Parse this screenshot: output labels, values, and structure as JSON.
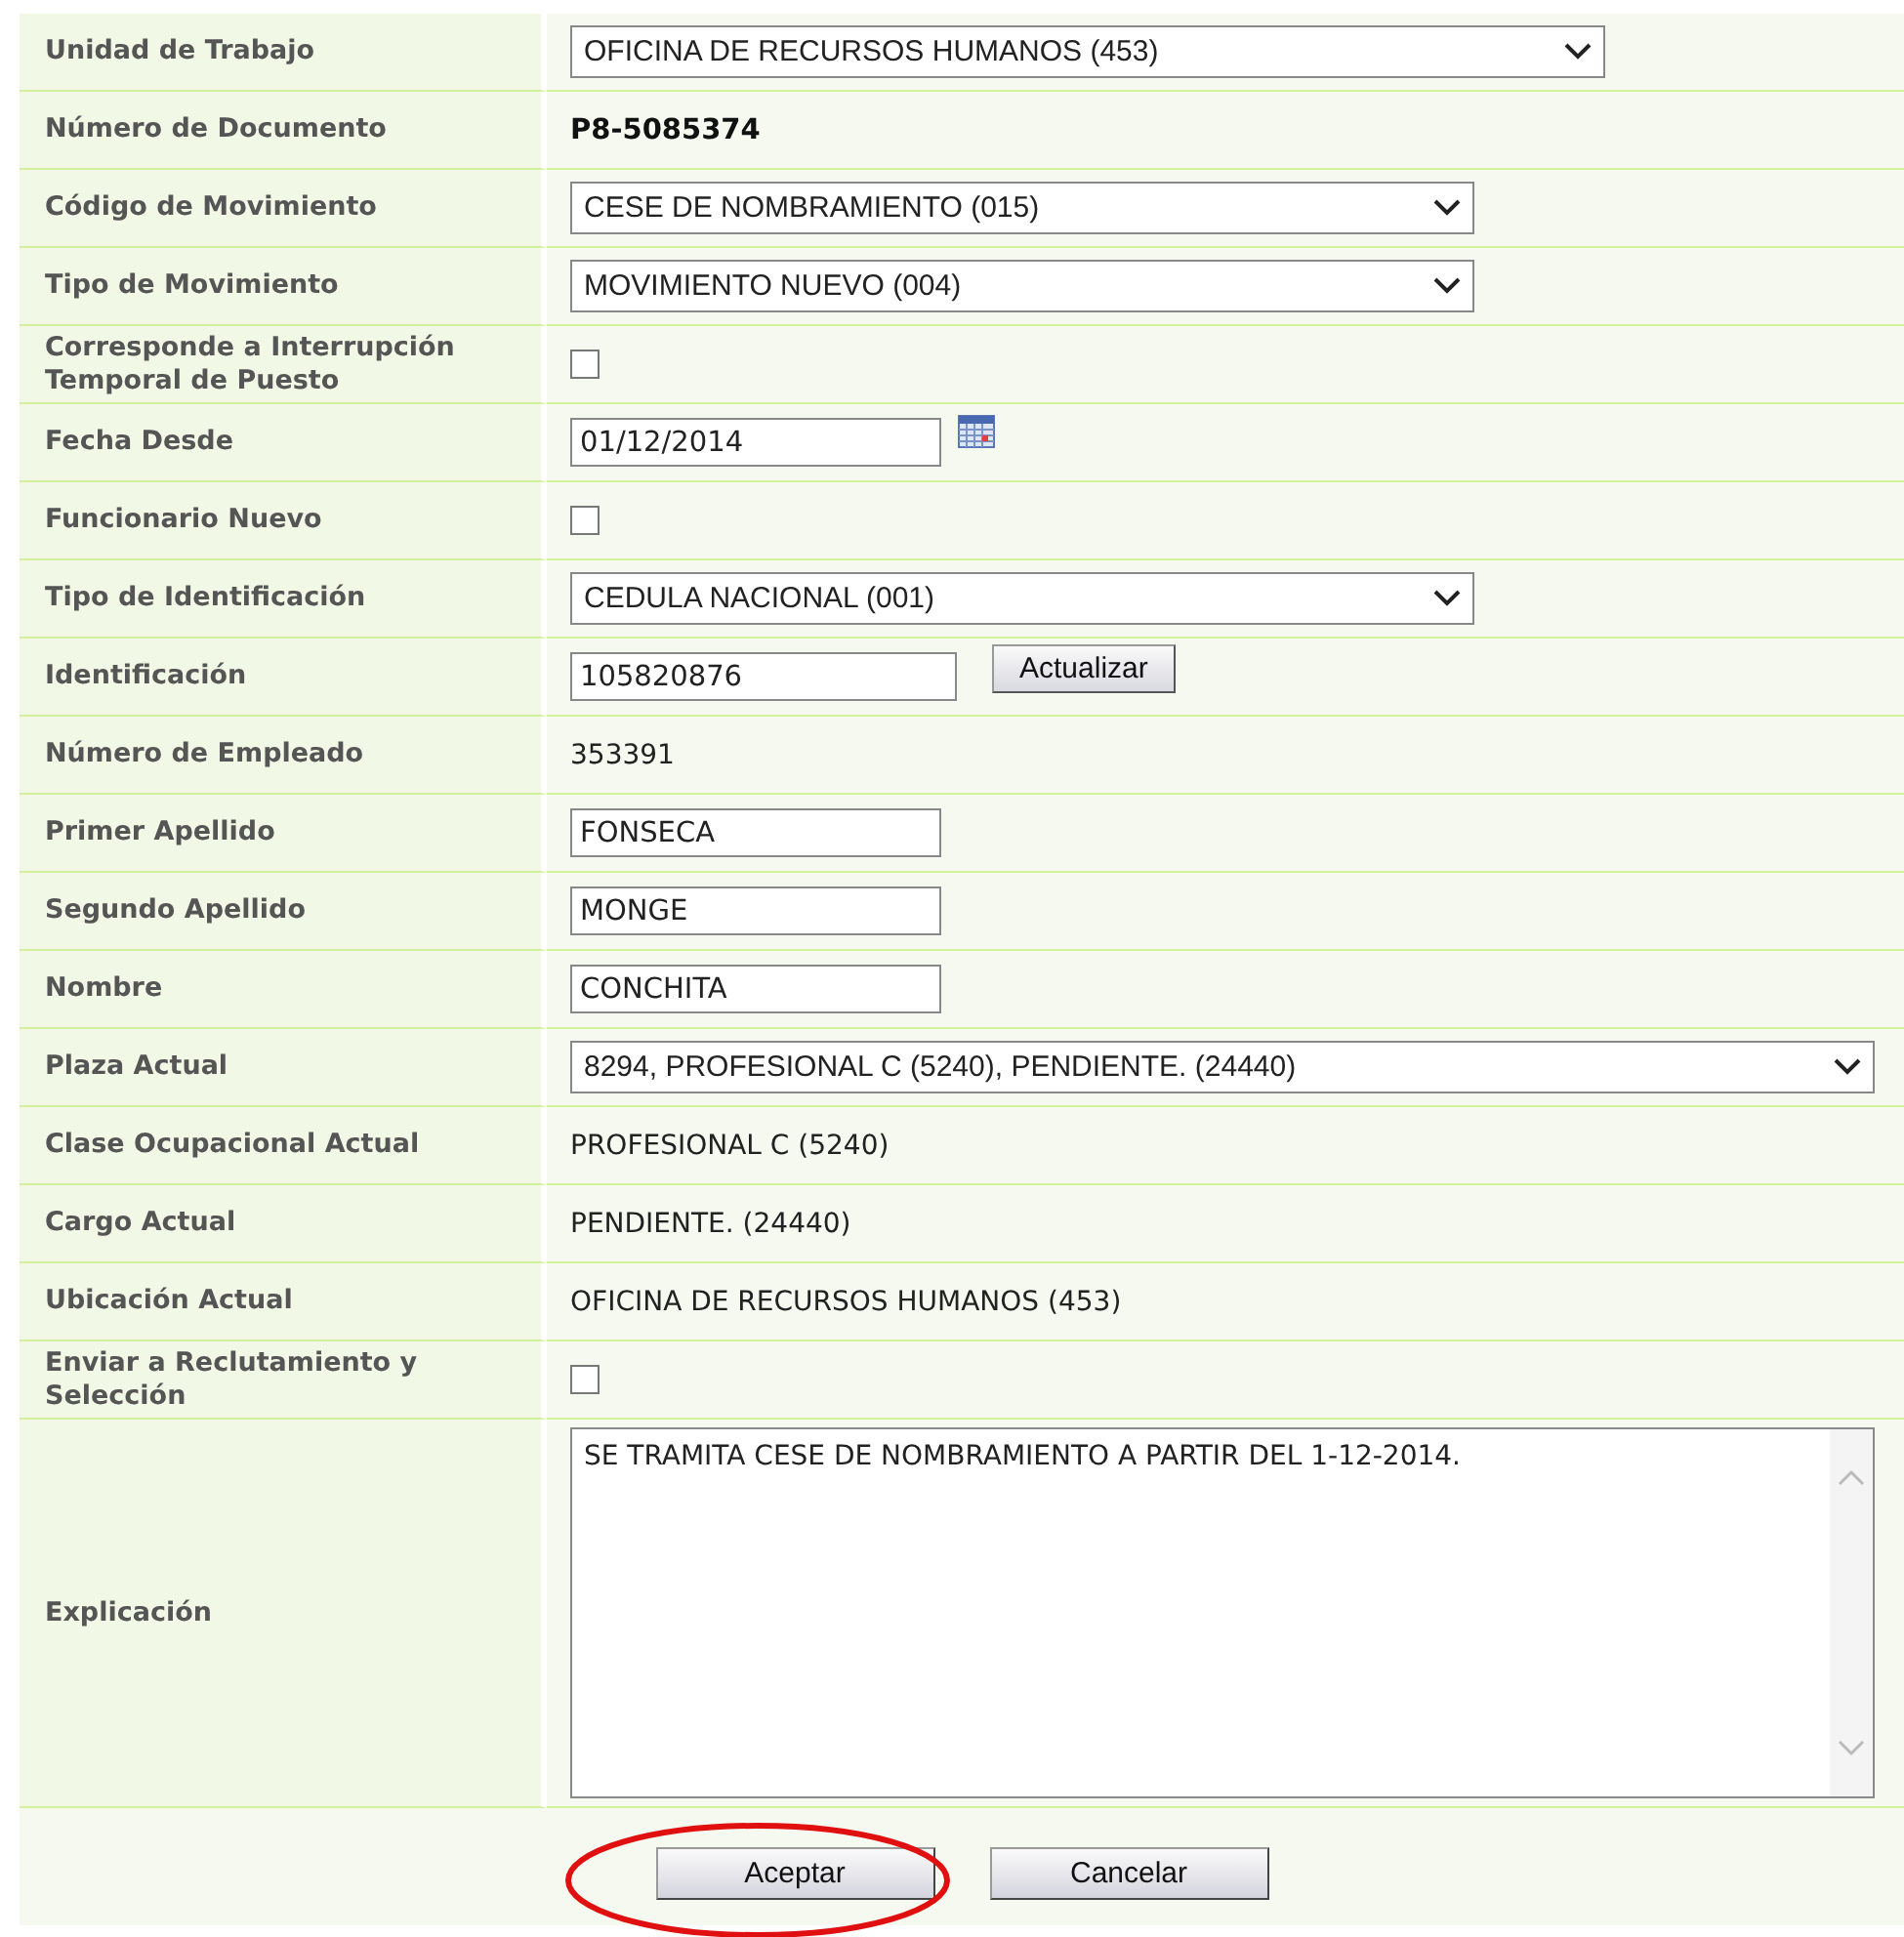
{
  "form": {
    "rows": [
      {
        "label": "Unidad de Trabajo",
        "kind": "select",
        "value": "OFICINA DE RECURSOS HUMANOS (453)"
      },
      {
        "label": "Número de Documento",
        "kind": "strong",
        "value": "P8-5085374"
      },
      {
        "label": "Código de Movimiento",
        "kind": "select",
        "value": "CESE DE NOMBRAMIENTO (015)"
      },
      {
        "label": "Tipo de Movimiento",
        "kind": "select",
        "value": "MOVIMIENTO NUEVO (004)"
      },
      {
        "label": "Corresponde a Interrupción Temporal de Puesto",
        "kind": "checkbox",
        "checked": false
      },
      {
        "label": "Fecha Desde",
        "kind": "date",
        "value": "01/12/2014"
      },
      {
        "label": "Funcionario Nuevo",
        "kind": "checkbox",
        "checked": false
      },
      {
        "label": "Tipo de Identificación",
        "kind": "select",
        "value": "CEDULA NACIONAL (001)"
      },
      {
        "label": "Identificación",
        "kind": "input-button",
        "value": "105820876",
        "button": "Actualizar"
      },
      {
        "label": "Número de Empleado",
        "kind": "text",
        "value": "353391"
      },
      {
        "label": "Primer Apellido",
        "kind": "input",
        "value": "FONSECA"
      },
      {
        "label": "Segundo Apellido",
        "kind": "input",
        "value": "MONGE"
      },
      {
        "label": "Nombre",
        "kind": "input",
        "value": "CONCHITA"
      },
      {
        "label": "Plaza Actual",
        "kind": "select",
        "value": "8294, PROFESIONAL C (5240), PENDIENTE. (24440)"
      },
      {
        "label": "Clase Ocupacional Actual",
        "kind": "text",
        "value": "PROFESIONAL C (5240)"
      },
      {
        "label": "Cargo Actual",
        "kind": "text",
        "value": "PENDIENTE. (24440)"
      },
      {
        "label": "Ubicación Actual",
        "kind": "text",
        "value": "OFICINA DE RECURSOS HUMANOS (453)"
      },
      {
        "label": "Enviar a Reclutamiento y Selección",
        "kind": "checkbox",
        "checked": false
      },
      {
        "label": "Explicación",
        "kind": "textarea",
        "value": "SE TRAMITA CESE DE NOMBRAMIENTO A PARTIR DEL 1-12-2014."
      }
    ]
  },
  "buttons": [
    {
      "label": "Aceptar",
      "circled": true
    },
    {
      "label": "Cancelar",
      "circled": false
    }
  ]
}
